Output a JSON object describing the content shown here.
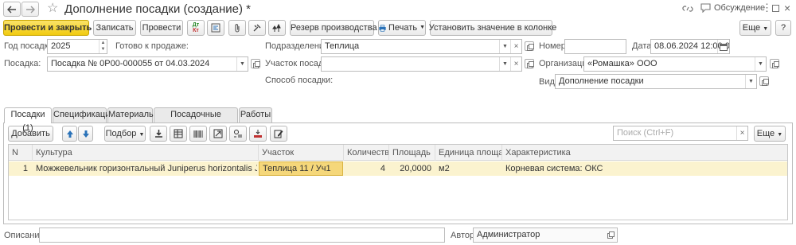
{
  "window": {
    "title": "Дополнение посадки (создание) *",
    "discussion": "Обсуждение"
  },
  "toolbar": {
    "post_close": "Провести и закрыть",
    "save": "Записать",
    "post": "Провести",
    "reserve": "Резерв производства",
    "print": "Печать",
    "set_value": "Установить значение в колонке",
    "more": "Еще"
  },
  "form": {
    "year_label": "Год посадки:",
    "year_value": "2025",
    "ready_label": "Готово к продаже:",
    "planting_label": "Посадка:",
    "planting_value": "Посадка № 0Р00-000055 от 04.03.2024",
    "division_label": "Подразделение:",
    "division_value": "Теплица",
    "plot_label": "Участок посадки:",
    "plot_value": "",
    "method_label": "Способ посадки:",
    "number_label": "Номер:",
    "number_value": "",
    "date_label": "Дата:",
    "date_value": "08.06.2024 12:00:00",
    "org_label": "Организация:",
    "org_value": "«Ромашка» ООО",
    "kind_label": "Вид:",
    "kind_value": "Дополнение посадки"
  },
  "tabs": [
    {
      "label": "Посадки (1)",
      "active": true
    },
    {
      "label": "Спецификации",
      "active": false
    },
    {
      "label": "Материалы",
      "active": false
    },
    {
      "label": "Посадочные материалы",
      "active": false
    },
    {
      "label": "Работы",
      "active": false
    }
  ],
  "table_toolbar": {
    "add": "Добавить",
    "pick": "Подбор",
    "search_placeholder": "Поиск (Ctrl+F)",
    "more": "Еще"
  },
  "table": {
    "columns": [
      "N",
      "Культура",
      "Участок",
      "Количество",
      "Площадь",
      "Единица площади",
      "Характеристика"
    ],
    "rows": [
      {
        "n": "1",
        "culture": "Можжевельник горизонтальный Juniperus horizontalis Jade River",
        "plot": "Теплица 11 / Уч1",
        "quantity": "4",
        "area": "20,0000",
        "unit": "м2",
        "characteristic": "Корневая система: ОКС"
      }
    ]
  },
  "footer": {
    "description_label": "Описание:",
    "description_value": "",
    "author_label": "Автор:",
    "author_value": "Администратор"
  },
  "colors": {
    "primary_button": "#f7d31c",
    "selected_row": "#fbf3cf",
    "active_cell": "#f5d77a"
  }
}
